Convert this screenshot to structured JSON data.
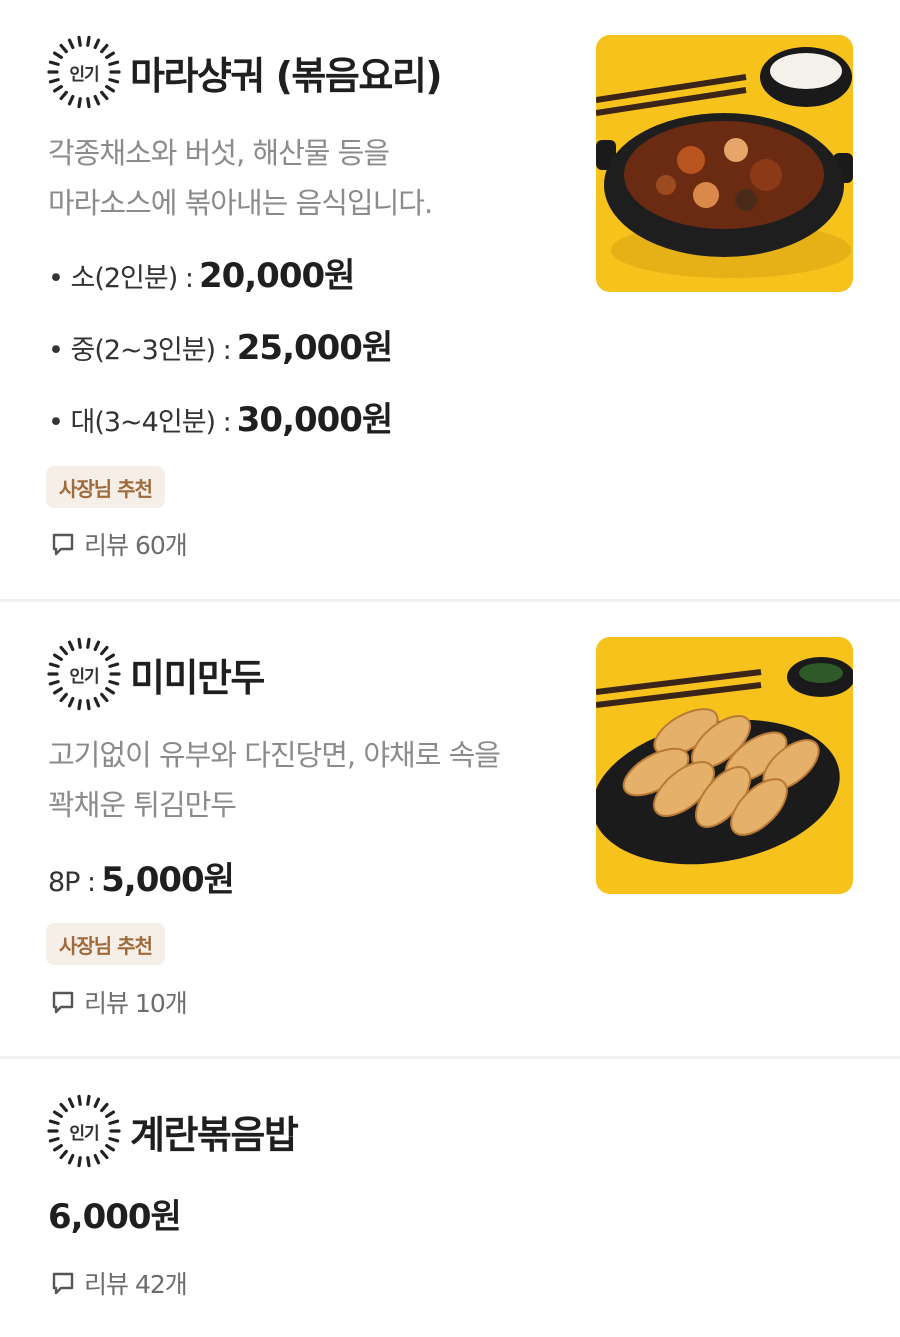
{
  "badge_text": "인기",
  "recommend_label": "사장님 추천",
  "colors": {
    "accent_yellow": "#f7c21c",
    "badge_bg": "#f5efe8",
    "badge_text": "#a06a3a"
  },
  "items": [
    {
      "name": "마라샹궈 (볶음요리)",
      "description": [
        "각종채소와 버섯, 해산물 등을",
        "마라소스에 볶아내는 음식입니다."
      ],
      "prices": [
        {
          "label": "• 소(2인분) :",
          "value": "20,000원"
        },
        {
          "label": "• 중(2~3인분) :",
          "value": "25,000원"
        },
        {
          "label": "• 대(3~4인분) :",
          "value": "30,000원"
        }
      ],
      "review_label": "리뷰 60개",
      "image_icon": "stir-fry-dish-photo"
    },
    {
      "name": "미미만두",
      "description": [
        "고기없이 유부와 다진당면, 야채로 속을",
        "꽉채운  튀김만두"
      ],
      "prices": [
        {
          "label": "8P :",
          "value": "5,000원"
        }
      ],
      "review_label": "리뷰 10개",
      "image_icon": "fried-dumplings-photo"
    },
    {
      "name": "계란볶음밥",
      "price": "6,000원",
      "review_label": "리뷰 42개"
    }
  ]
}
